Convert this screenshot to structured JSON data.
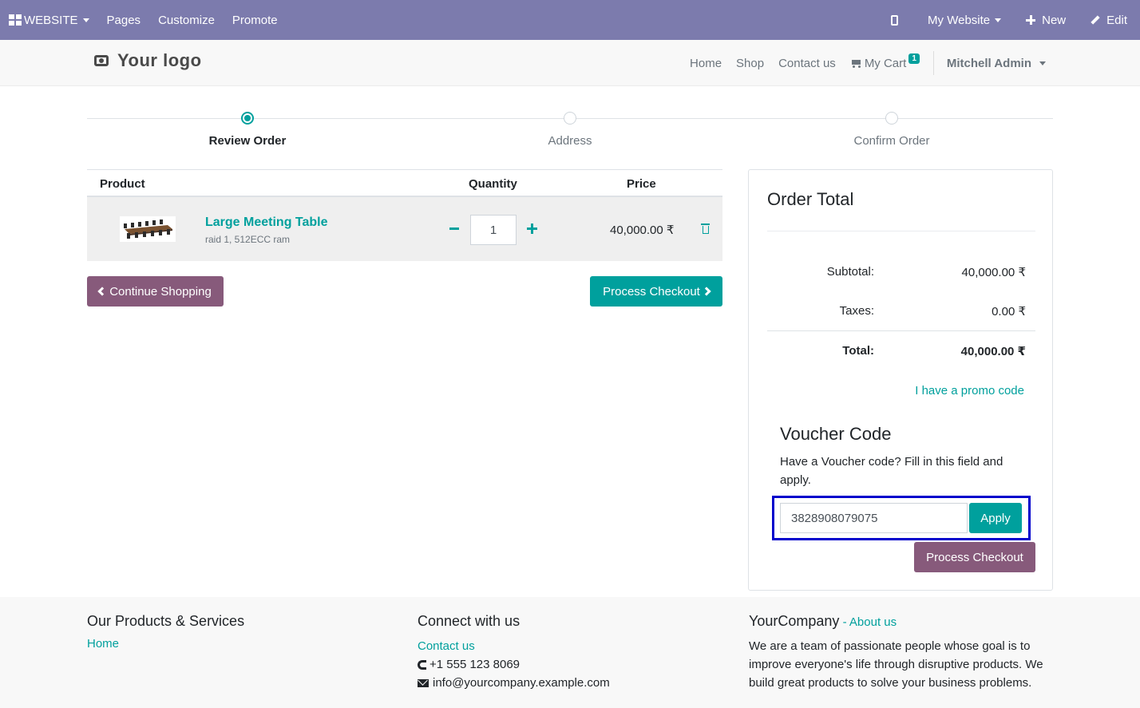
{
  "adminbar": {
    "brand": "WEBSITE",
    "menu": [
      "Pages",
      "Customize",
      "Promote"
    ],
    "site": "My Website",
    "new": "New",
    "edit": "Edit"
  },
  "header": {
    "logo": "Your logo",
    "nav": [
      "Home",
      "Shop",
      "Contact us"
    ],
    "cart_label": "My Cart",
    "cart_count": "1",
    "user": "Mitchell Admin"
  },
  "wizard": {
    "steps": [
      "Review Order",
      "Address",
      "Confirm Order"
    ],
    "active": 0
  },
  "cart": {
    "headers": {
      "product": "Product",
      "quantity": "Quantity",
      "price": "Price"
    },
    "items": [
      {
        "name": "Large Meeting Table",
        "description": "raid 1, 512ECC ram",
        "quantity": "1",
        "price": "40,000.00 ₹"
      }
    ],
    "continue_label": "Continue Shopping",
    "checkout_label": "Process Checkout"
  },
  "totals": {
    "title": "Order Total",
    "subtotal_label": "Subtotal:",
    "subtotal": "40,000.00 ₹",
    "taxes_label": "Taxes:",
    "taxes": "0.00 ₹",
    "total_label": "Total:",
    "total": "40,000.00 ₹",
    "promo_link": "I have a promo code"
  },
  "voucher": {
    "title": "Voucher Code",
    "description": "Have a Voucher code? Fill in this field and apply.",
    "value": "3828908079075",
    "apply_label": "Apply",
    "checkout_label": "Process Checkout"
  },
  "footer": {
    "col1_title": "Our Products & Services",
    "col1_link": "Home",
    "col2_title": "Connect with us",
    "col2_link": "Contact us",
    "phone": "+1 555 123 8069",
    "email": "info@yourcompany.example.com",
    "col3_title": "YourCompany",
    "col3_sep": " - ",
    "col3_link": "About us",
    "col3_text": "We are a team of passionate people whose goal is to improve everyone's life through disruptive products. We build great products to solve your business problems."
  },
  "colors": {
    "adminbar": "#7c7bad",
    "accent": "#00a09d",
    "secondary": "#875a7b",
    "highlight": "#0000cc"
  }
}
